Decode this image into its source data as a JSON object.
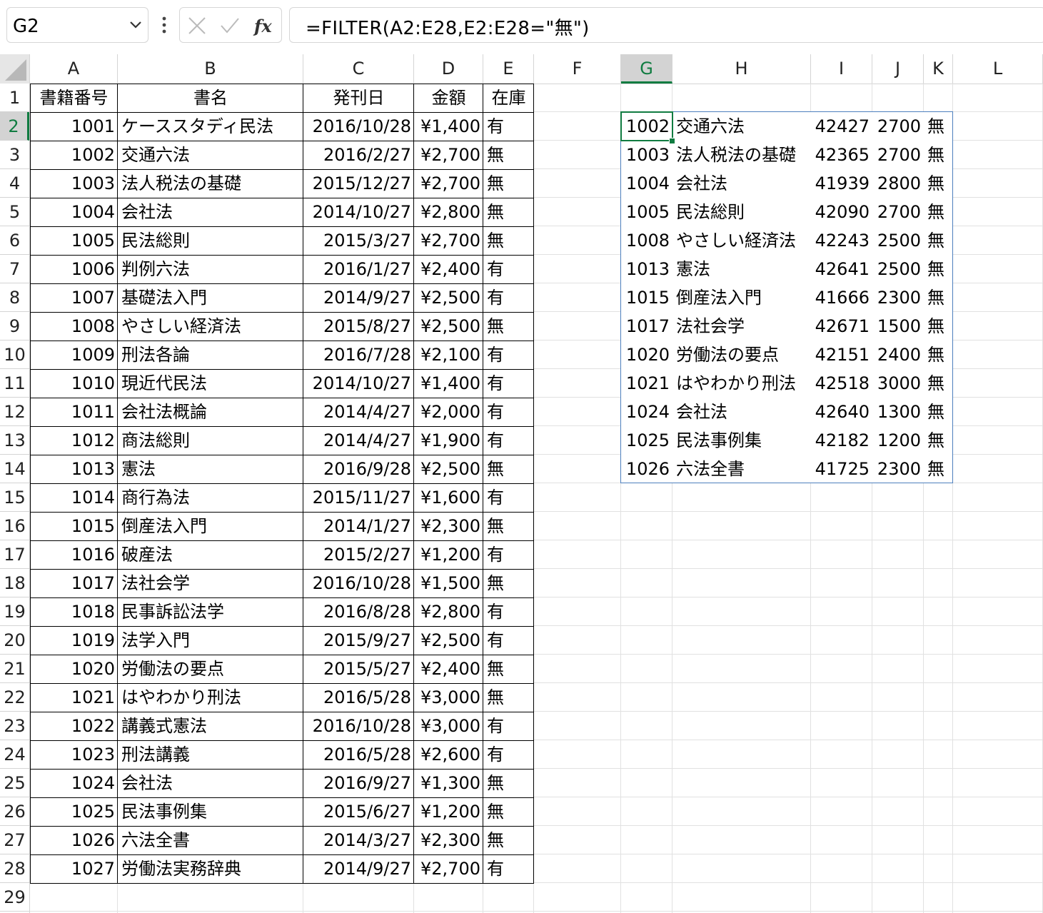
{
  "name_box": "G2",
  "formula": "=FILTER(A2:E28,E2:E28=\"無\")",
  "columns": [
    "A",
    "B",
    "C",
    "D",
    "E",
    "F",
    "G",
    "H",
    "I",
    "J",
    "K",
    "L"
  ],
  "selected_column": "G",
  "selected_row": "2",
  "row_numbers": [
    "1",
    "2",
    "3",
    "4",
    "5",
    "6",
    "7",
    "8",
    "9",
    "10",
    "11",
    "12",
    "13",
    "14",
    "15",
    "16",
    "17",
    "18",
    "19",
    "20",
    "21",
    "22",
    "23",
    "24",
    "25",
    "26",
    "27",
    "28",
    "29"
  ],
  "headers": [
    "書籍番号",
    "書名",
    "発刊日",
    "金額",
    "在庫"
  ],
  "rows": [
    [
      "1001",
      "ケーススタディ民法",
      "2016/10/28",
      "¥1,400",
      "有"
    ],
    [
      "1002",
      "交通六法",
      "2016/2/27",
      "¥2,700",
      "無"
    ],
    [
      "1003",
      "法人税法の基礎",
      "2015/12/27",
      "¥2,700",
      "無"
    ],
    [
      "1004",
      "会社法",
      "2014/10/27",
      "¥2,800",
      "無"
    ],
    [
      "1005",
      "民法総則",
      "2015/3/27",
      "¥2,700",
      "無"
    ],
    [
      "1006",
      "判例六法",
      "2016/1/27",
      "¥2,400",
      "有"
    ],
    [
      "1007",
      "基礎法入門",
      "2014/9/27",
      "¥2,500",
      "有"
    ],
    [
      "1008",
      "やさしい経済法",
      "2015/8/27",
      "¥2,500",
      "無"
    ],
    [
      "1009",
      "刑法各論",
      "2016/7/28",
      "¥2,100",
      "有"
    ],
    [
      "1010",
      "現近代民法",
      "2014/10/27",
      "¥1,400",
      "有"
    ],
    [
      "1011",
      "会社法概論",
      "2014/4/27",
      "¥2,000",
      "有"
    ],
    [
      "1012",
      "商法総則",
      "2014/4/27",
      "¥1,900",
      "有"
    ],
    [
      "1013",
      "憲法",
      "2016/9/28",
      "¥2,500",
      "無"
    ],
    [
      "1014",
      "商行為法",
      "2015/11/27",
      "¥1,600",
      "有"
    ],
    [
      "1015",
      "倒産法入門",
      "2014/1/27",
      "¥2,300",
      "無"
    ],
    [
      "1016",
      "破産法",
      "2015/2/27",
      "¥1,200",
      "有"
    ],
    [
      "1017",
      "法社会学",
      "2016/10/28",
      "¥1,500",
      "無"
    ],
    [
      "1018",
      "民事訴訟法学",
      "2016/8/28",
      "¥2,800",
      "有"
    ],
    [
      "1019",
      "法学入門",
      "2015/9/27",
      "¥2,500",
      "有"
    ],
    [
      "1020",
      "労働法の要点",
      "2015/5/27",
      "¥2,400",
      "無"
    ],
    [
      "1021",
      "はやわかり刑法",
      "2016/5/28",
      "¥3,000",
      "無"
    ],
    [
      "1022",
      "講義式憲法",
      "2016/10/28",
      "¥3,000",
      "有"
    ],
    [
      "1023",
      "刑法講義",
      "2016/5/28",
      "¥2,600",
      "有"
    ],
    [
      "1024",
      "会社法",
      "2016/9/27",
      "¥1,300",
      "無"
    ],
    [
      "1025",
      "民法事例集",
      "2015/6/27",
      "¥1,200",
      "無"
    ],
    [
      "1026",
      "六法全書",
      "2014/3/27",
      "¥2,300",
      "無"
    ],
    [
      "1027",
      "労働法実務辞典",
      "2014/9/27",
      "¥2,700",
      "有"
    ]
  ],
  "spill": [
    [
      "1002",
      "交通六法",
      "42427",
      "2700",
      "無"
    ],
    [
      "1003",
      "法人税法の基礎",
      "42365",
      "2700",
      "無"
    ],
    [
      "1004",
      "会社法",
      "41939",
      "2800",
      "無"
    ],
    [
      "1005",
      "民法総則",
      "42090",
      "2700",
      "無"
    ],
    [
      "1008",
      "やさしい経済法",
      "42243",
      "2500",
      "無"
    ],
    [
      "1013",
      "憲法",
      "42641",
      "2500",
      "無"
    ],
    [
      "1015",
      "倒産法入門",
      "41666",
      "2300",
      "無"
    ],
    [
      "1017",
      "法社会学",
      "42671",
      "1500",
      "無"
    ],
    [
      "1020",
      "労働法の要点",
      "42151",
      "2400",
      "無"
    ],
    [
      "1021",
      "はやわかり刑法",
      "42518",
      "3000",
      "無"
    ],
    [
      "1024",
      "会社法",
      "42640",
      "1300",
      "無"
    ],
    [
      "1025",
      "民法事例集",
      "42182",
      "1200",
      "無"
    ],
    [
      "1026",
      "六法全書",
      "41725",
      "2300",
      "無"
    ]
  ],
  "colors": {
    "accent": "#107c41",
    "spill_border": "#4d7fbd",
    "gridline": "#e1e1e1"
  },
  "icons": [
    "chevron-down-icon",
    "more-vertical-icon",
    "cancel-x-icon",
    "enter-check-icon",
    "insert-function-icon"
  ]
}
